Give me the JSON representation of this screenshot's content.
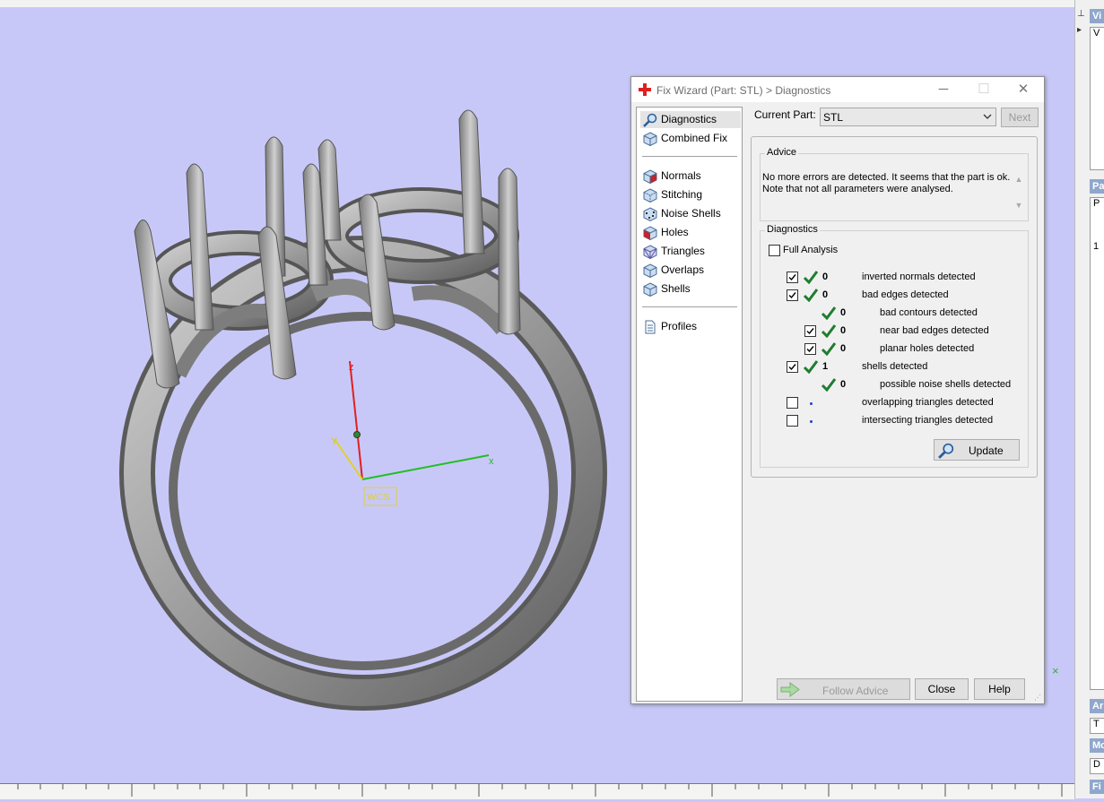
{
  "viewport": {
    "axis_labels": {
      "z": "z",
      "y": "Y",
      "x": "x"
    },
    "wcs_label": "WCS",
    "colors": {
      "background": "#c8c8f8",
      "z_axis": "#e02020",
      "x_axis": "#20c020",
      "y_axis": "#e0d030",
      "part": "#9a9a9a"
    }
  },
  "dialog": {
    "title": "Fix Wizard (Part: STL) > Diagnostics",
    "window_buttons": {
      "minimize": "─",
      "maximize": "☐",
      "close": "✕"
    },
    "nav": {
      "items": [
        {
          "label": "Diagnostics",
          "icon": "magnifier-icon",
          "selected": true
        },
        {
          "label": "Combined Fix",
          "icon": "cube-icon"
        },
        {
          "label": "Normals",
          "icon": "normals-cube-icon"
        },
        {
          "label": "Stitching",
          "icon": "stitching-cube-icon"
        },
        {
          "label": "Noise Shells",
          "icon": "noise-cube-icon"
        },
        {
          "label": "Holes",
          "icon": "holes-cube-icon"
        },
        {
          "label": "Triangles",
          "icon": "triangles-cube-icon"
        },
        {
          "label": "Overlaps",
          "icon": "overlaps-cube-icon"
        },
        {
          "label": "Shells",
          "icon": "shells-cube-icon"
        },
        {
          "label": "Profiles",
          "icon": "document-icon"
        }
      ]
    },
    "current_part": {
      "label": "Current Part:",
      "value": "STL"
    },
    "next_label": "Next",
    "advice": {
      "title": "Advice",
      "text": "No more errors are detected. It seems that the part is ok. Note that not all parameters were analysed."
    },
    "diagnostics": {
      "title": "Diagnostics",
      "full_analysis_label": "Full Analysis",
      "full_analysis_checked": false,
      "rows": [
        {
          "checked": true,
          "status": "ok",
          "count": "0",
          "label": "inverted normals detected",
          "indent": 0
        },
        {
          "checked": true,
          "status": "ok",
          "count": "0",
          "label": "bad edges detected",
          "indent": 0
        },
        {
          "checked": null,
          "status": "ok",
          "count": "0",
          "label": "bad contours detected",
          "indent": 1
        },
        {
          "checked": true,
          "status": "ok",
          "count": "0",
          "label": "near bad edges detected",
          "indent": 1
        },
        {
          "checked": true,
          "status": "ok",
          "count": "0",
          "label": "planar holes detected",
          "indent": 1
        },
        {
          "checked": true,
          "status": "ok",
          "count": "1",
          "label": "shells detected",
          "indent": 0
        },
        {
          "checked": null,
          "status": "ok",
          "count": "0",
          "label": "possible noise shells detected",
          "indent": 1
        },
        {
          "checked": false,
          "status": "not-run",
          "count": "",
          "label": "overlapping triangles detected",
          "indent": 0
        },
        {
          "checked": false,
          "status": "not-run",
          "count": "",
          "label": "intersecting triangles detected",
          "indent": 0
        }
      ],
      "update_label": "Update"
    },
    "footer": {
      "follow_advice_label": "Follow Advice",
      "close_label": "Close",
      "help_label": "Help"
    }
  },
  "right_panel": {
    "headers": [
      "Vi",
      "Pa",
      "Ar",
      "Mo",
      "Fi"
    ],
    "fields": [
      "V",
      "P",
      "1",
      "T",
      "D"
    ]
  }
}
